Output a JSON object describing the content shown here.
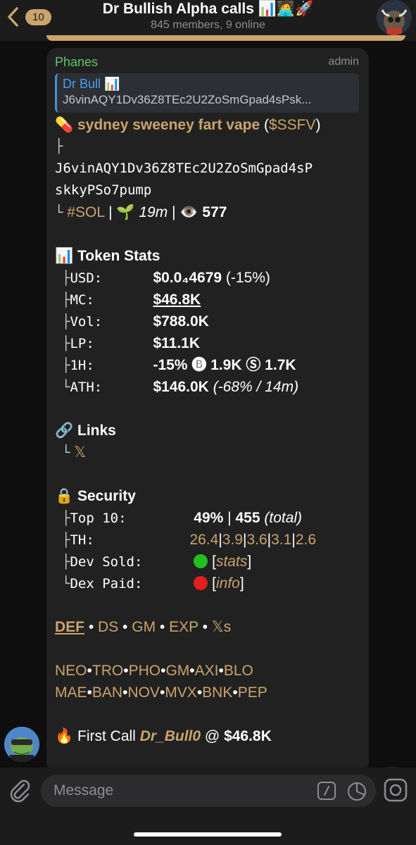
{
  "header": {
    "back_badge": "10",
    "title": "Dr Bullish Alpha calls 📊🧑‍💻🚀",
    "subtitle": "845 members, 9 online"
  },
  "message": {
    "sender": "Phanes",
    "role": "admin",
    "reply": {
      "name": "Dr Bull 📊",
      "text": "J6vinAQY1Dv36Z8TEc2U2ZoSmGpad4sPsk..."
    },
    "token_line": {
      "emoji": "💊",
      "name": "sydney sweeney fart vape",
      "ticker_open": "(",
      "ticker": "$SSFV",
      "ticker_close": ")"
    },
    "address_branch": "├",
    "address_1": "J6vinAQY1Dv36Z8TEc2U2ZoSmGpad4sP",
    "address_2": "skkyPSo7pump",
    "chain_line": {
      "branch": "└",
      "chain": "#SOL",
      "sep1": "|",
      "age_emoji": "🌱",
      "age": "19m",
      "sep2": "|",
      "views_emoji": "👁️",
      "views": "577"
    },
    "stats": {
      "heading_emoji": "📊",
      "heading": "Token Stats",
      "rows": [
        {
          "branch": "├",
          "label": "USD:",
          "value": "$0.0₄4679",
          "extra": " (-15%)"
        },
        {
          "branch": "├",
          "label": "MC:",
          "value": "$46.8K",
          "extra": ""
        },
        {
          "branch": "├",
          "label": "Vol:",
          "value": "$788.0K",
          "extra": ""
        },
        {
          "branch": "├",
          "label": "LP:",
          "value": "$11.1K",
          "extra": ""
        },
        {
          "branch": "├",
          "label": "1H:",
          "value": "-15%",
          "extra": " 🅑 1.9K Ⓢ 1.7K"
        },
        {
          "branch": "└",
          "label": "ATH:",
          "value": "$146.0K",
          "extra": " (-68% / 14m)"
        }
      ]
    },
    "links": {
      "heading_emoji": "🔗",
      "heading": "Links",
      "branch": "└",
      "x_link": "𝕏"
    },
    "security": {
      "heading_emoji": "🔒",
      "heading": "Security",
      "top10": {
        "branch": "├",
        "label": "Top 10:",
        "value": "49%",
        "sep": "|",
        "count": "455",
        "count_note": "(total)"
      },
      "th": {
        "branch": "├",
        "label": "TH:",
        "values": [
          "26.4",
          "3.9",
          "3.6",
          "3.1",
          "2.6"
        ],
        "sep": "|"
      },
      "dev_sold": {
        "branch": "├",
        "label": "Dev Sold:",
        "status_color": "#22c01e",
        "link": "stats"
      },
      "dex_paid": {
        "branch": "└",
        "label": "Dex Paid:",
        "status_color": "#e0201a",
        "link": "info"
      }
    },
    "nav_links": [
      "DEF",
      "DS",
      "GM",
      "EXP",
      "𝕏s"
    ],
    "bots_row1": [
      "NEO",
      "TRO",
      "PHO",
      "GM",
      "AXI",
      "BLO"
    ],
    "bots_row2": [
      "MAE",
      "BAN",
      "NOV",
      "MVX",
      "BNK",
      "PEP"
    ],
    "first_call": {
      "emoji": "🔥",
      "label": "First Call",
      "user": "Dr_Bull0",
      "at": "@",
      "value": "$46.8K"
    }
  },
  "input": {
    "placeholder": "Message"
  },
  "colors": {
    "accent_gold": "#c9a46c",
    "sender_green": "#5fc76a",
    "reply_blue": "#4a9fee",
    "bubble_bg": "#212121"
  }
}
